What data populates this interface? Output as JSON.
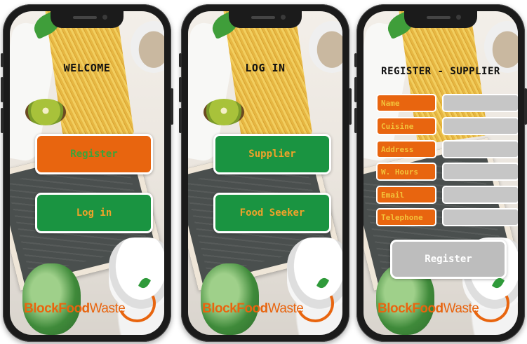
{
  "brand": {
    "logo_part1": "BlockFood",
    "logo_part2": "Waste",
    "colors": {
      "orange": "#e8650f",
      "green": "#1a9441",
      "gray": "#bdbdbd"
    }
  },
  "screens": [
    {
      "title": "WELCOME",
      "buttons": [
        {
          "label": "Register",
          "style": "orange"
        },
        {
          "label": "Log in",
          "style": "green"
        }
      ]
    },
    {
      "title": "LOG IN",
      "buttons": [
        {
          "label": "Supplier",
          "style": "green"
        },
        {
          "label": "Food Seeker",
          "style": "green"
        }
      ]
    },
    {
      "title": "REGISTER - SUPPLIER",
      "fields": [
        {
          "label": "Name",
          "value": ""
        },
        {
          "label": "Cuisine",
          "value": ""
        },
        {
          "label": "Address",
          "value": ""
        },
        {
          "label": "W. Hours",
          "value": ""
        },
        {
          "label": "Email",
          "value": ""
        },
        {
          "label": "Telephone",
          "value": ""
        }
      ],
      "submit_label": "Register"
    }
  ]
}
